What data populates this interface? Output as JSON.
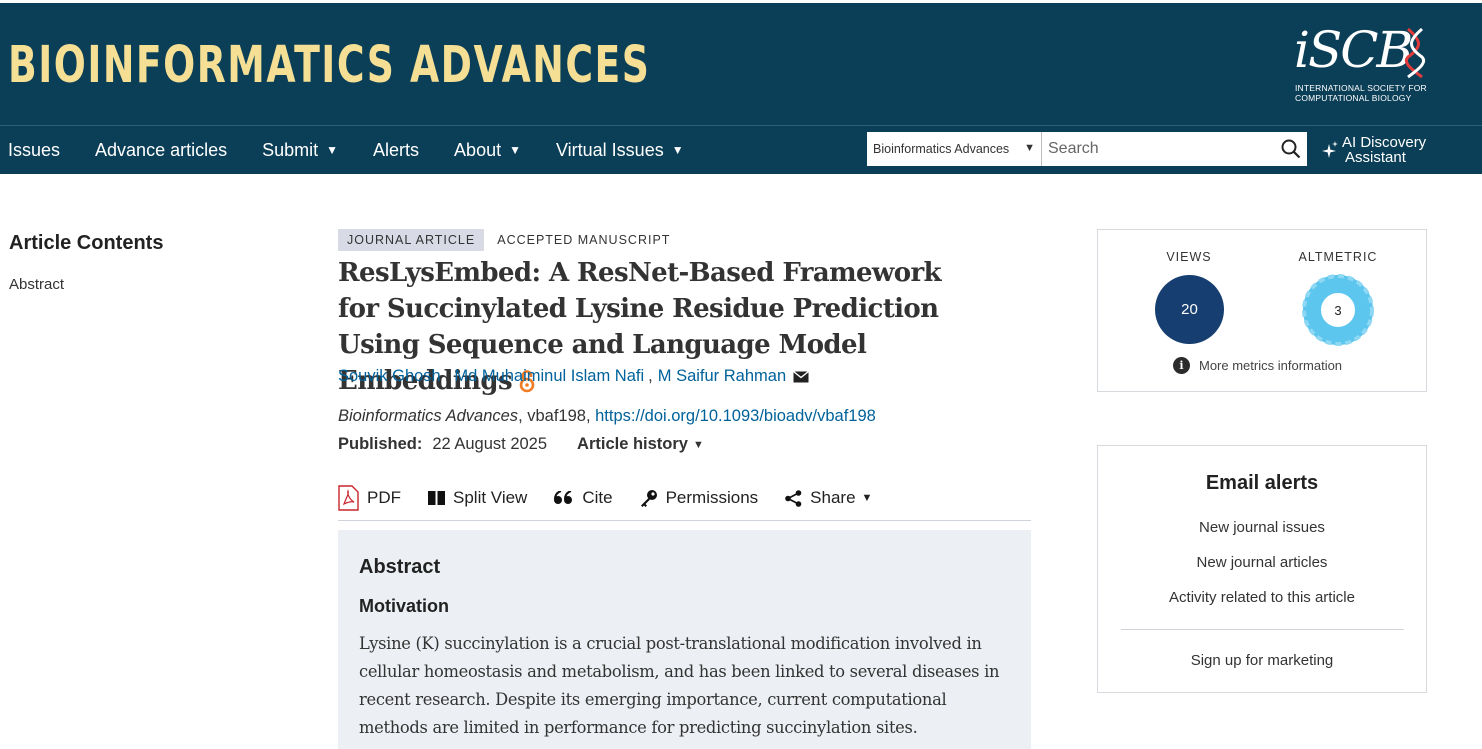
{
  "header": {
    "journal_name": "BIOINFORMATICS ADVANCES",
    "society_logo": {
      "wordmark": "iSCB",
      "subtitle_line1": "INTERNATIONAL SOCIETY FOR",
      "subtitle_line2": "COMPUTATIONAL BIOLOGY"
    },
    "colors": {
      "band": "#0b3f57",
      "title": "#f4df94"
    }
  },
  "nav": {
    "items": [
      {
        "label": "Issues"
      },
      {
        "label": "Advance articles"
      },
      {
        "label": "Submit",
        "has_caret": true
      },
      {
        "label": "Alerts"
      },
      {
        "label": "About",
        "has_caret": true
      },
      {
        "label": "Virtual Issues",
        "has_caret": true
      }
    ],
    "caret": "▼",
    "search": {
      "scope_selected": "Bioinformatics Advances",
      "placeholder": "Search",
      "scope_icon": "caret-down-icon",
      "button_icon": "search-icon"
    },
    "ai_assistant": {
      "line1": "AI Discovery",
      "line2": "Assistant",
      "icon": "sparkle-icon"
    }
  },
  "sidebar": {
    "title": "Article Contents",
    "items": [
      {
        "label": "Abstract"
      }
    ]
  },
  "article": {
    "type_badge": "JOURNAL ARTICLE",
    "status_badge": "ACCEPTED MANUSCRIPT",
    "title": "ResLysEmbed: A ResNet-Based Framework for Succinylated Lysine Residue Prediction Using Sequence and Language Model Embeddings",
    "open_access_icon": "open-access-icon",
    "authors": [
      {
        "name": "Souvik Ghosh"
      },
      {
        "name": "Md Muhaiminul Islam Nafi"
      },
      {
        "name": "M Saifur Rahman"
      }
    ],
    "author_separator": ",",
    "citation": {
      "journal": "Bioinformatics Advances",
      "article_id": ", vbaf198, ",
      "doi": "https://doi.org/10.1093/bioadv/vbaf198"
    },
    "published_label": "Published:",
    "published_date": "22 August 2025",
    "history_label": "Article history",
    "history_caret": "▼",
    "toolbar": [
      {
        "label": "PDF",
        "icon": "pdf-icon"
      },
      {
        "label": "Split View",
        "icon": "split-view-icon"
      },
      {
        "label": "Cite",
        "icon": "quote-icon"
      },
      {
        "label": "Permissions",
        "icon": "key-icon"
      },
      {
        "label": "Share",
        "icon": "share-icon",
        "caret": "▼"
      }
    ],
    "abstract": {
      "heading": "Abstract",
      "subheading": "Motivation",
      "text": "Lysine (K) succinylation is a crucial post-translational modification involved in cellular homeostasis and metabolism, and has been linked to several diseases in recent research. Despite its emerging importance, current computational methods are limited in performance for predicting succinylation sites."
    }
  },
  "metrics": {
    "views_label": "VIEWS",
    "views_value": "20",
    "altmetric_label": "ALTMETRIC",
    "altmetric_value": "3",
    "info_glyph": "i",
    "more_link": "More metrics information",
    "colors": {
      "views": "#173e70",
      "altmetric": "#5cc6ee"
    }
  },
  "email_alerts": {
    "title": "Email alerts",
    "links": [
      {
        "label": "New journal issues"
      },
      {
        "label": "New journal articles"
      },
      {
        "label": "Activity related to this article"
      },
      {
        "label": "Sign up for marketing"
      }
    ]
  }
}
